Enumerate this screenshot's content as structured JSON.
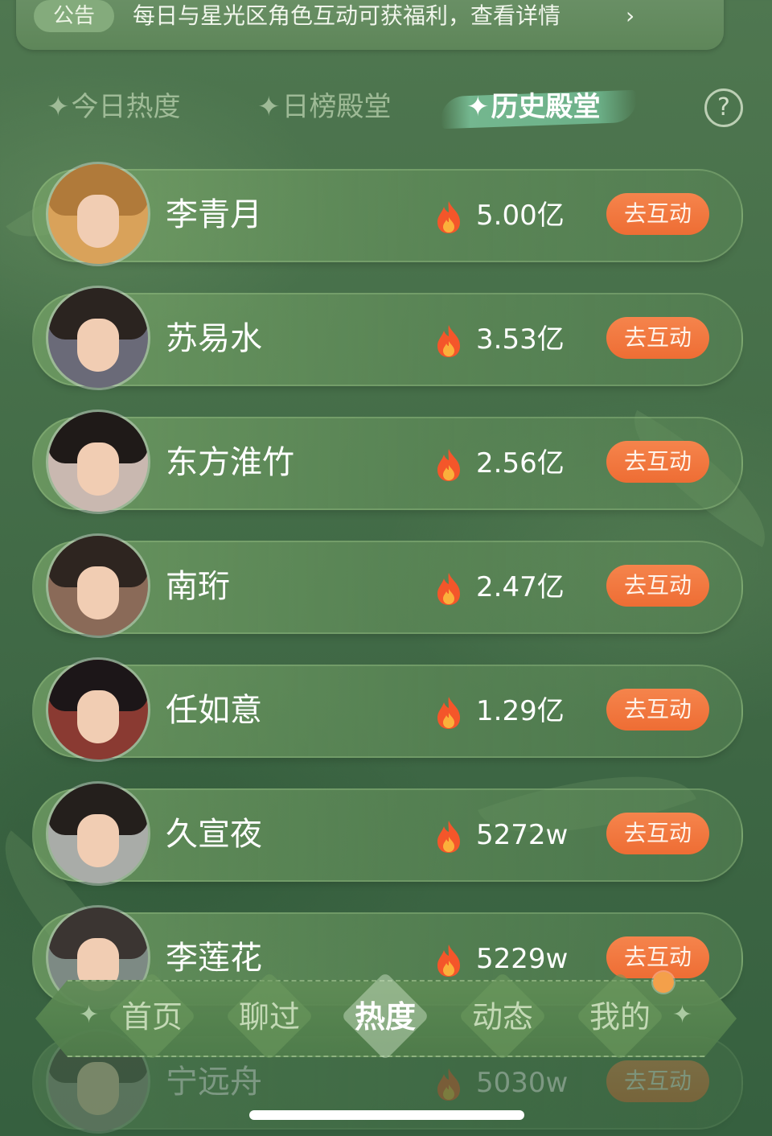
{
  "notice": {
    "tag": "公告",
    "text": "每日与星光区角色互动可获福利，查看详情",
    "chevron": "›"
  },
  "tabs": [
    {
      "label": "今日热度",
      "active": false
    },
    {
      "label": "日榜殿堂",
      "active": false
    },
    {
      "label": "历史殿堂",
      "active": true
    }
  ],
  "tab_star": "✦",
  "help_icon": "?",
  "action_label": "去互动",
  "ranking": [
    {
      "name": "李青月",
      "score": "5.00亿"
    },
    {
      "name": "苏易水",
      "score": "3.53亿"
    },
    {
      "name": "东方淮竹",
      "score": "2.56亿"
    },
    {
      "name": "南珩",
      "score": "2.47亿"
    },
    {
      "name": "任如意",
      "score": "1.29亿"
    },
    {
      "name": "久宣夜",
      "score": "5272w"
    },
    {
      "name": "李莲花",
      "score": "5229w"
    },
    {
      "name": "宁远舟",
      "score": "5030w"
    }
  ],
  "bottom_nav": [
    {
      "label": "首页",
      "active": false
    },
    {
      "label": "聊过",
      "active": false
    },
    {
      "label": "热度",
      "active": true
    },
    {
      "label": "动态",
      "active": false
    },
    {
      "label": "我的",
      "active": false
    }
  ],
  "nav_star": "✦",
  "colors": {
    "background": "#47704a",
    "action_button": "#ee6d34",
    "badge_dot": "#f4a04a",
    "active_tab_brush": "#6eb48c"
  },
  "icons": {
    "fire": "fire-icon",
    "help": "help-icon",
    "chevron": "chevron-right-icon",
    "sparkle": "sparkle-icon"
  }
}
